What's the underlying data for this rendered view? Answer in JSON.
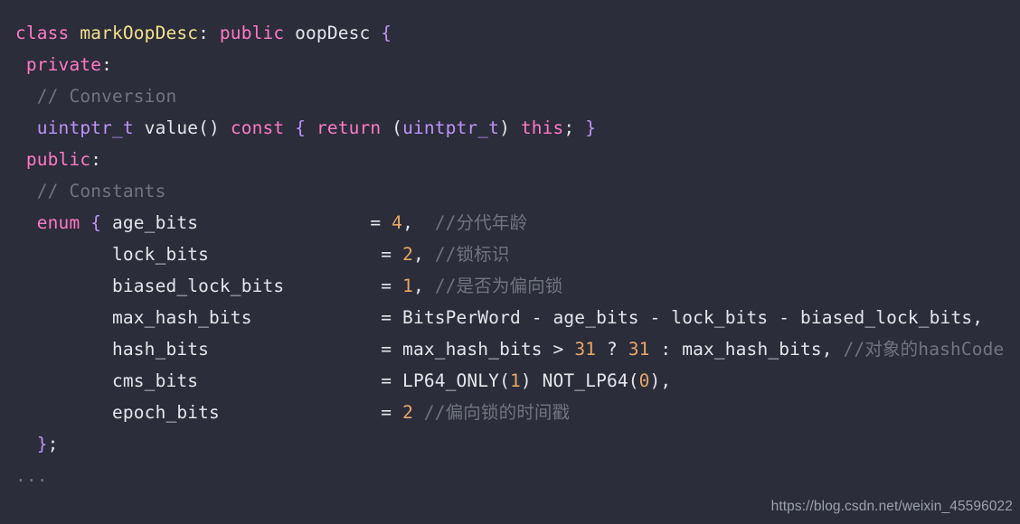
{
  "editor": {
    "background_color": "#2b2d3a",
    "language": "cpp",
    "colors": {
      "keyword": "#ff79c6",
      "class_name": "#f3e28a",
      "type": "#bd93f9",
      "identifier": "#e4e6ec",
      "number": "#e8a765",
      "comment": "#70757f",
      "punctuation": "#e4e6ec"
    },
    "lines": [
      {
        "id": "line-1",
        "tokens": [
          {
            "text": "class ",
            "kind": "kw"
          },
          {
            "text": "markOopDesc",
            "kind": "cls"
          },
          {
            "text": ": ",
            "kind": "pun"
          },
          {
            "text": "public ",
            "kind": "kw"
          },
          {
            "text": "oopDesc ",
            "kind": "id"
          },
          {
            "text": "{",
            "kind": "brace"
          }
        ]
      },
      {
        "id": "line-2",
        "tokens": [
          {
            "text": " ",
            "kind": "pun"
          },
          {
            "text": "private",
            "kind": "kw"
          },
          {
            "text": ":",
            "kind": "pun"
          }
        ]
      },
      {
        "id": "line-3",
        "tokens": [
          {
            "text": "  ",
            "kind": "pun"
          },
          {
            "text": "// Conversion",
            "kind": "com"
          }
        ]
      },
      {
        "id": "line-4",
        "tokens": [
          {
            "text": "  ",
            "kind": "pun"
          },
          {
            "text": "uintptr_t",
            "kind": "type"
          },
          {
            "text": " value() ",
            "kind": "id"
          },
          {
            "text": "const ",
            "kind": "kw"
          },
          {
            "text": "{ ",
            "kind": "brace"
          },
          {
            "text": "return ",
            "kind": "kw"
          },
          {
            "text": "(",
            "kind": "pun"
          },
          {
            "text": "uintptr_t",
            "kind": "type"
          },
          {
            "text": ") ",
            "kind": "pun"
          },
          {
            "text": "this",
            "kind": "kw"
          },
          {
            "text": "; ",
            "kind": "pun"
          },
          {
            "text": "}",
            "kind": "brace"
          }
        ]
      },
      {
        "id": "line-5",
        "tokens": [
          {
            "text": " ",
            "kind": "pun"
          },
          {
            "text": "public",
            "kind": "kw"
          },
          {
            "text": ":",
            "kind": "pun"
          }
        ]
      },
      {
        "id": "line-6",
        "tokens": [
          {
            "text": "  ",
            "kind": "pun"
          },
          {
            "text": "// Constants",
            "kind": "com"
          }
        ]
      },
      {
        "id": "line-7",
        "tokens": [
          {
            "text": "  ",
            "kind": "pun"
          },
          {
            "text": "enum ",
            "kind": "kw"
          },
          {
            "text": "{ ",
            "kind": "brace"
          },
          {
            "text": "age_bits",
            "kind": "id"
          },
          {
            "text": "                ",
            "kind": "pun"
          },
          {
            "text": "= ",
            "kind": "pun"
          },
          {
            "text": "4",
            "kind": "num"
          },
          {
            "text": ",  ",
            "kind": "pun"
          },
          {
            "text": "//分代年龄",
            "kind": "com"
          }
        ]
      },
      {
        "id": "line-8",
        "tokens": [
          {
            "text": "         ",
            "kind": "pun"
          },
          {
            "text": "lock_bits",
            "kind": "id"
          },
          {
            "text": "                ",
            "kind": "pun"
          },
          {
            "text": "= ",
            "kind": "pun"
          },
          {
            "text": "2",
            "kind": "num"
          },
          {
            "text": ", ",
            "kind": "pun"
          },
          {
            "text": "//锁标识",
            "kind": "com"
          }
        ]
      },
      {
        "id": "line-9",
        "tokens": [
          {
            "text": "         ",
            "kind": "pun"
          },
          {
            "text": "biased_lock_bits",
            "kind": "id"
          },
          {
            "text": "         ",
            "kind": "pun"
          },
          {
            "text": "= ",
            "kind": "pun"
          },
          {
            "text": "1",
            "kind": "num"
          },
          {
            "text": ", ",
            "kind": "pun"
          },
          {
            "text": "//是否为偏向锁",
            "kind": "com"
          }
        ]
      },
      {
        "id": "line-10",
        "tokens": [
          {
            "text": "         ",
            "kind": "pun"
          },
          {
            "text": "max_hash_bits",
            "kind": "id"
          },
          {
            "text": "            ",
            "kind": "pun"
          },
          {
            "text": "= BitsPerWord - age_bits - lock_bits - biased_lock_bits,",
            "kind": "id"
          }
        ]
      },
      {
        "id": "line-11",
        "tokens": [
          {
            "text": "         ",
            "kind": "pun"
          },
          {
            "text": "hash_bits",
            "kind": "id"
          },
          {
            "text": "                ",
            "kind": "pun"
          },
          {
            "text": "= max_hash_bits > ",
            "kind": "id"
          },
          {
            "text": "31",
            "kind": "num"
          },
          {
            "text": " ? ",
            "kind": "pun"
          },
          {
            "text": "31",
            "kind": "num"
          },
          {
            "text": " : max_hash_bits, ",
            "kind": "id"
          },
          {
            "text": "//对象的hashCode",
            "kind": "com"
          }
        ]
      },
      {
        "id": "line-12",
        "tokens": [
          {
            "text": "         ",
            "kind": "pun"
          },
          {
            "text": "cms_bits",
            "kind": "id"
          },
          {
            "text": "                 ",
            "kind": "pun"
          },
          {
            "text": "= LP64_ONLY(",
            "kind": "id"
          },
          {
            "text": "1",
            "kind": "num"
          },
          {
            "text": ") NOT_LP64(",
            "kind": "id"
          },
          {
            "text": "0",
            "kind": "num"
          },
          {
            "text": "),",
            "kind": "pun"
          }
        ]
      },
      {
        "id": "line-13",
        "tokens": [
          {
            "text": "         ",
            "kind": "pun"
          },
          {
            "text": "epoch_bits",
            "kind": "id"
          },
          {
            "text": "               ",
            "kind": "pun"
          },
          {
            "text": "= ",
            "kind": "pun"
          },
          {
            "text": "2",
            "kind": "num"
          },
          {
            "text": " ",
            "kind": "pun"
          },
          {
            "text": "//偏向锁的时间戳",
            "kind": "com"
          }
        ]
      },
      {
        "id": "line-14",
        "tokens": [
          {
            "text": "  ",
            "kind": "pun"
          },
          {
            "text": "}",
            "kind": "brace"
          },
          {
            "text": ";",
            "kind": "pun"
          }
        ]
      },
      {
        "id": "line-15",
        "tokens": [
          {
            "text": "...",
            "kind": "com"
          }
        ]
      }
    ]
  },
  "watermark": {
    "text": "https://blog.csdn.net/weixin_45596022"
  }
}
